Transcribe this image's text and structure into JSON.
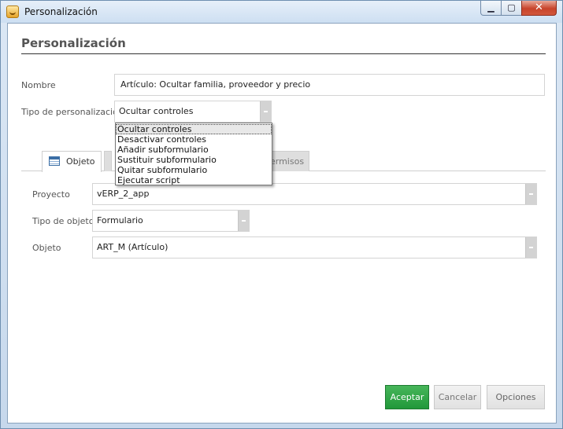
{
  "window": {
    "title": "Personalización",
    "minimize_label": "▁",
    "maximize_label": "▢",
    "close_label": "✕"
  },
  "panel": {
    "title": "Personalización"
  },
  "form": {
    "nombre_label": "Nombre",
    "nombre_value": "Artículo: Ocultar familia, proveedor y precio",
    "tipo_label": "Tipo de personalización",
    "tipo_value": "Ocultar controles"
  },
  "dropdown": {
    "options": [
      "Ocultar controles",
      "Desactivar controles",
      "Añadir subformulario",
      "Sustituir subformulario",
      "Quitar subformulario",
      "Ejecutar script"
    ],
    "selected_index": 0
  },
  "tabs": [
    {
      "label": "Objeto",
      "active": true
    },
    {
      "label": "",
      "active": false
    },
    {
      "label": "ermisos",
      "active": false
    }
  ],
  "objeto": {
    "proyecto_label": "Proyecto",
    "proyecto_value": "vERP_2_app",
    "tipo_objeto_label": "Tipo de objeto",
    "tipo_objeto_value": "Formulario",
    "objeto_label": "Objeto",
    "objeto_value": "ART_M  (Artículo)"
  },
  "buttons": {
    "accept": "Aceptar",
    "cancel": "Cancelar",
    "options": "Opciones"
  },
  "colors": {
    "accept_button": "#2ba343",
    "title_bar": "#cddff2",
    "close_button": "#c7442b"
  }
}
